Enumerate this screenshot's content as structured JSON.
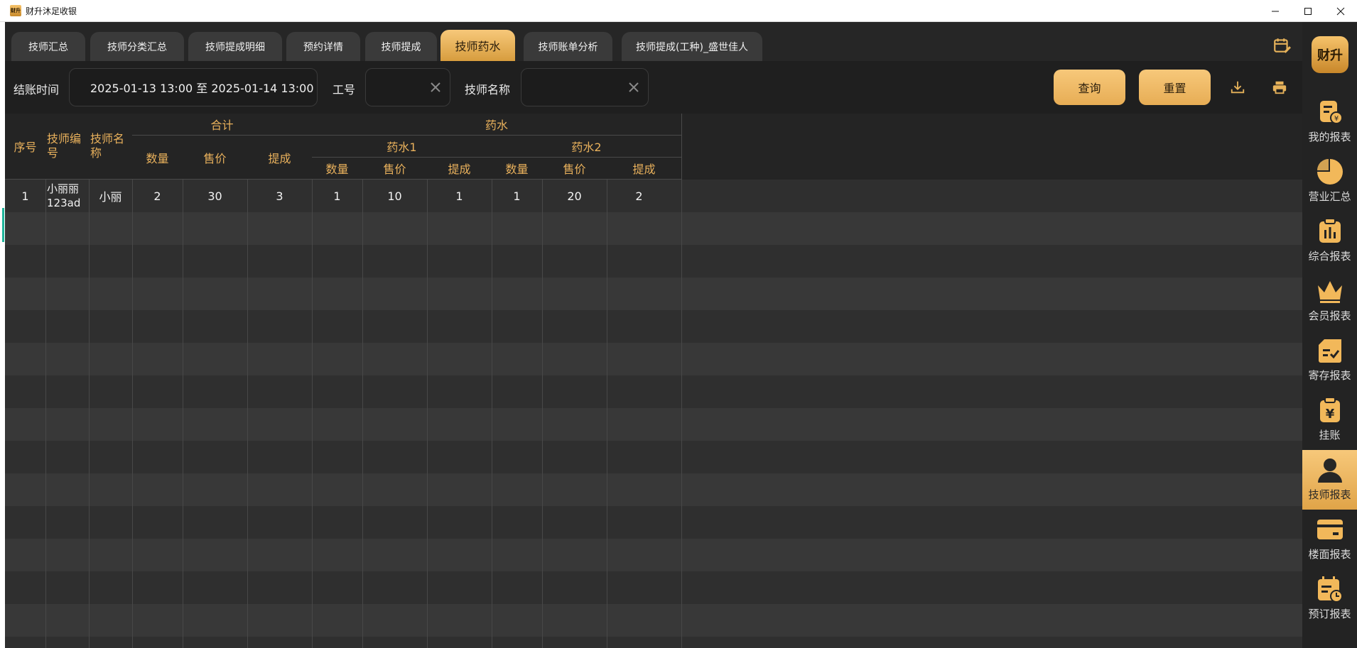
{
  "window": {
    "title": "财升沐足收银",
    "app_icon_text": "财升"
  },
  "tabs": [
    {
      "label": "技师汇总"
    },
    {
      "label": "技师分类汇总"
    },
    {
      "label": "技师提成明细"
    },
    {
      "label": "预约详情"
    },
    {
      "label": "技师提成"
    },
    {
      "label": "技师药水",
      "active": true
    },
    {
      "label": "技师账单分析"
    },
    {
      "label": "技师提成(工种)_盛世佳人"
    }
  ],
  "filters": {
    "date_label": "结账时间",
    "date_value": "2025-01-13 13:00  至  2025-01-14 13:00",
    "id_label": "工号",
    "id_value": "",
    "name_label": "技师名称",
    "name_value": "",
    "query_button": "查询",
    "reset_button": "重置"
  },
  "table": {
    "headers": {
      "seq": "序号",
      "tech_id": "技师编号",
      "tech_name": "技师名称",
      "total_group": "合计",
      "potion_group": "药水",
      "potion1": "药水1",
      "potion2": "药水2",
      "qty": "数量",
      "price": "售价",
      "commission": "提成"
    },
    "rows": [
      {
        "seq": "1",
        "tech_id": "小丽丽123ad",
        "tech_name": "小丽",
        "total_qty": "2",
        "total_price": "30",
        "total_commission": "3",
        "p1_qty": "1",
        "p1_price": "10",
        "p1_commission": "1",
        "p2_qty": "1",
        "p2_price": "20",
        "p2_commission": "2"
      }
    ]
  },
  "sidebar": {
    "logo_text": "财升",
    "items": [
      {
        "label": "我的报表",
        "icon": "report-yen-icon"
      },
      {
        "label": "营业汇总",
        "icon": "pie-chart-icon"
      },
      {
        "label": "综合报表",
        "icon": "clipboard-bar-icon"
      },
      {
        "label": "会员报表",
        "icon": "crown-icon"
      },
      {
        "label": "寄存报表",
        "icon": "storage-check-icon"
      },
      {
        "label": "挂账",
        "icon": "credit-yen-icon"
      },
      {
        "label": "技师报表",
        "icon": "person-icon",
        "active": true
      },
      {
        "label": "楼面报表",
        "icon": "card-icon"
      },
      {
        "label": "预订报表",
        "icon": "calendar-clock-icon"
      }
    ]
  },
  "colors": {
    "accent": "#e9b15c",
    "active_tab": "#f0b965",
    "left_marker": "#1fb59a"
  }
}
